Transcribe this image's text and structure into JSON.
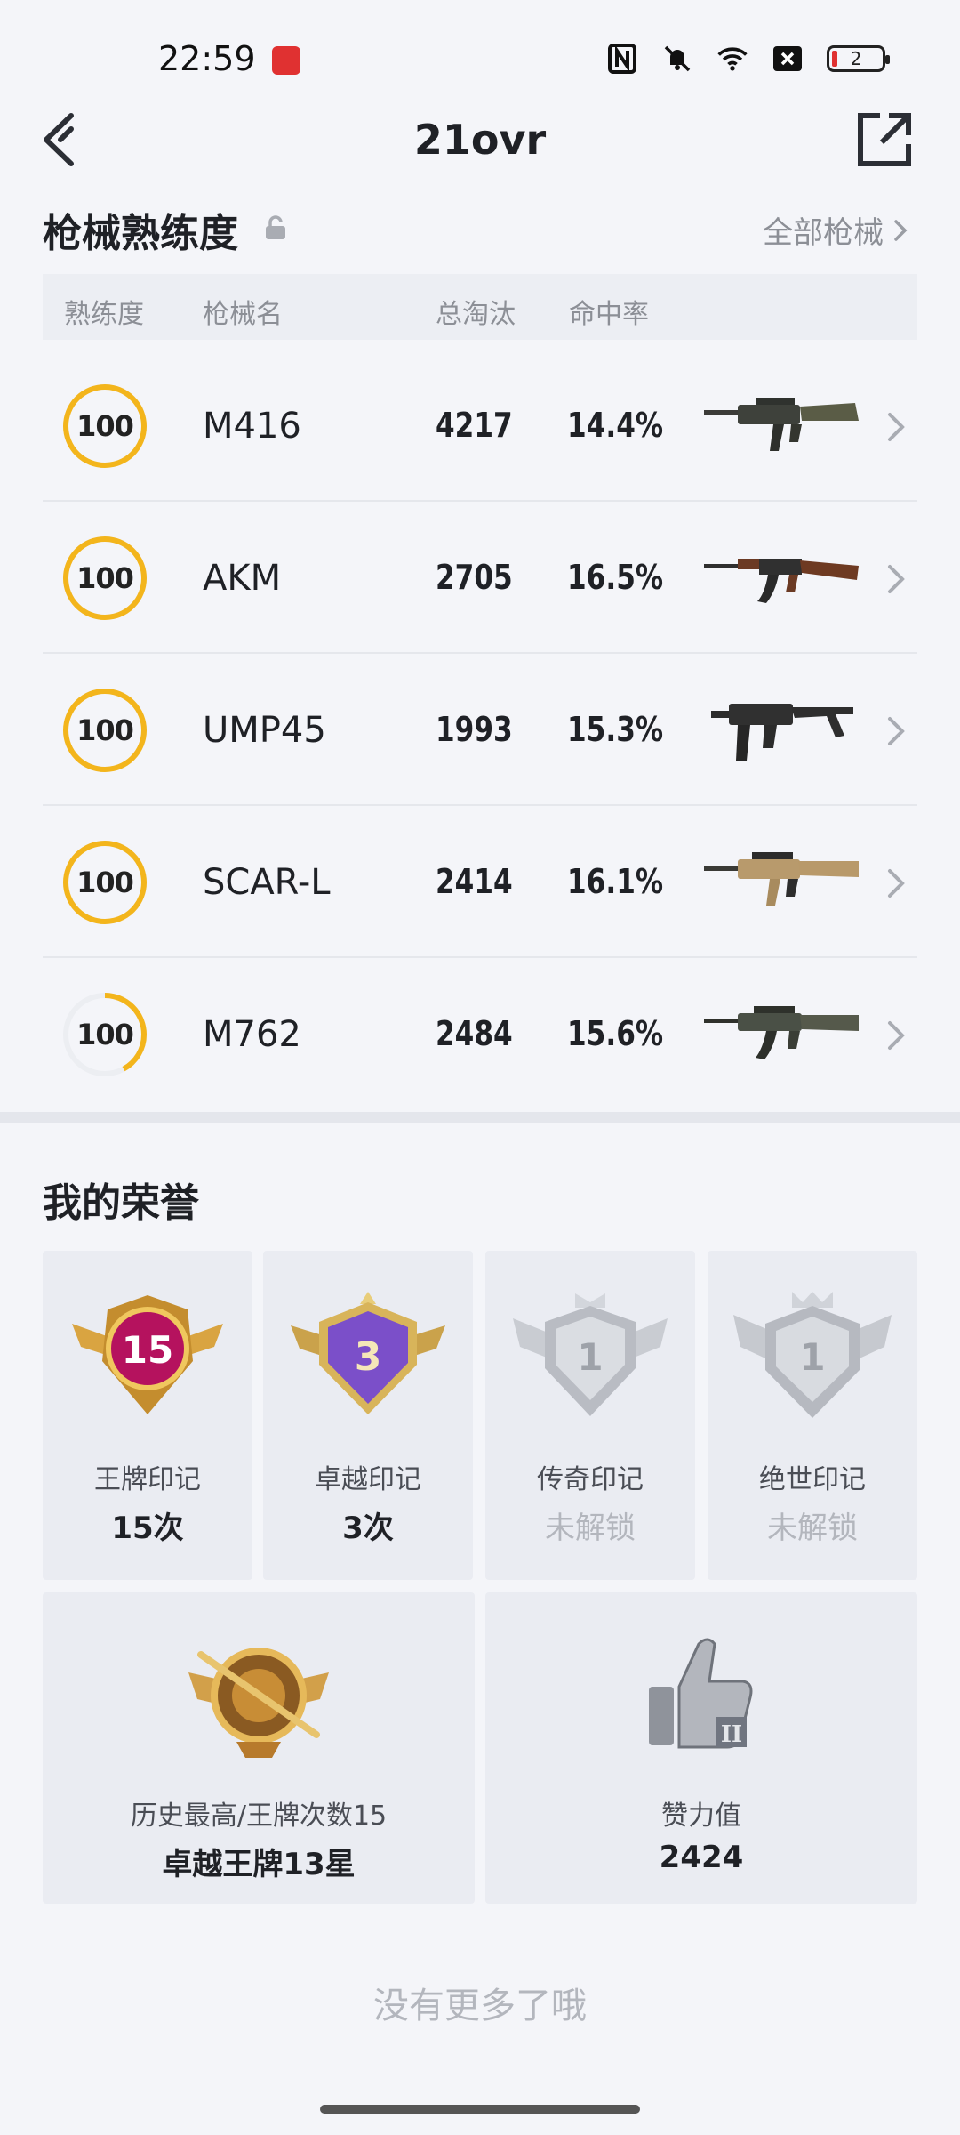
{
  "status_bar": {
    "time": "22:59",
    "battery_level": "2",
    "icons": [
      "app-icon",
      "nfc-icon",
      "mute-icon",
      "wifi-icon",
      "sim-off-icon",
      "battery-icon"
    ]
  },
  "header": {
    "title": "21ovr"
  },
  "weapons": {
    "section_title": "枪械熟练度",
    "all_link": "全部枪械",
    "columns": {
      "proficiency": "熟练度",
      "name": "枪械名",
      "kills": "总淘汰",
      "accuracy": "命中率"
    },
    "rows": [
      {
        "level": "100",
        "progress": 1.0,
        "name": "M416",
        "kills": "4217",
        "accuracy": "14.4%"
      },
      {
        "level": "100",
        "progress": 1.0,
        "name": "AKM",
        "kills": "2705",
        "accuracy": "16.5%"
      },
      {
        "level": "100",
        "progress": 1.0,
        "name": "UMP45",
        "kills": "1993",
        "accuracy": "15.3%"
      },
      {
        "level": "100",
        "progress": 1.0,
        "name": "SCAR-L",
        "kills": "2414",
        "accuracy": "16.1%"
      },
      {
        "level": "100",
        "progress": 0.42,
        "name": "M762",
        "kills": "2484",
        "accuracy": "15.6%"
      }
    ]
  },
  "honors": {
    "section_title": "我的荣誉",
    "badges": [
      {
        "badge_number": "15",
        "label": "王牌印记",
        "value": "15次",
        "locked": false
      },
      {
        "badge_number": "3",
        "label": "卓越印记",
        "value": "3次",
        "locked": false
      },
      {
        "badge_number": "1",
        "label": "传奇印记",
        "value": "未解锁",
        "locked": true
      },
      {
        "badge_number": "1",
        "label": "绝世印记",
        "value": "未解锁",
        "locked": true
      }
    ],
    "highest": {
      "label": "历史最高/王牌次数15",
      "value": "卓越王牌13星"
    },
    "likes": {
      "label": "赞力值",
      "value": "2424"
    }
  },
  "footer": {
    "no_more": "没有更多了哦"
  },
  "colors": {
    "ring": "#f3b51c",
    "ring_track": "#eceef2",
    "accent_gold": "#d9a441",
    "legend_purple": "#7b4fc9"
  }
}
